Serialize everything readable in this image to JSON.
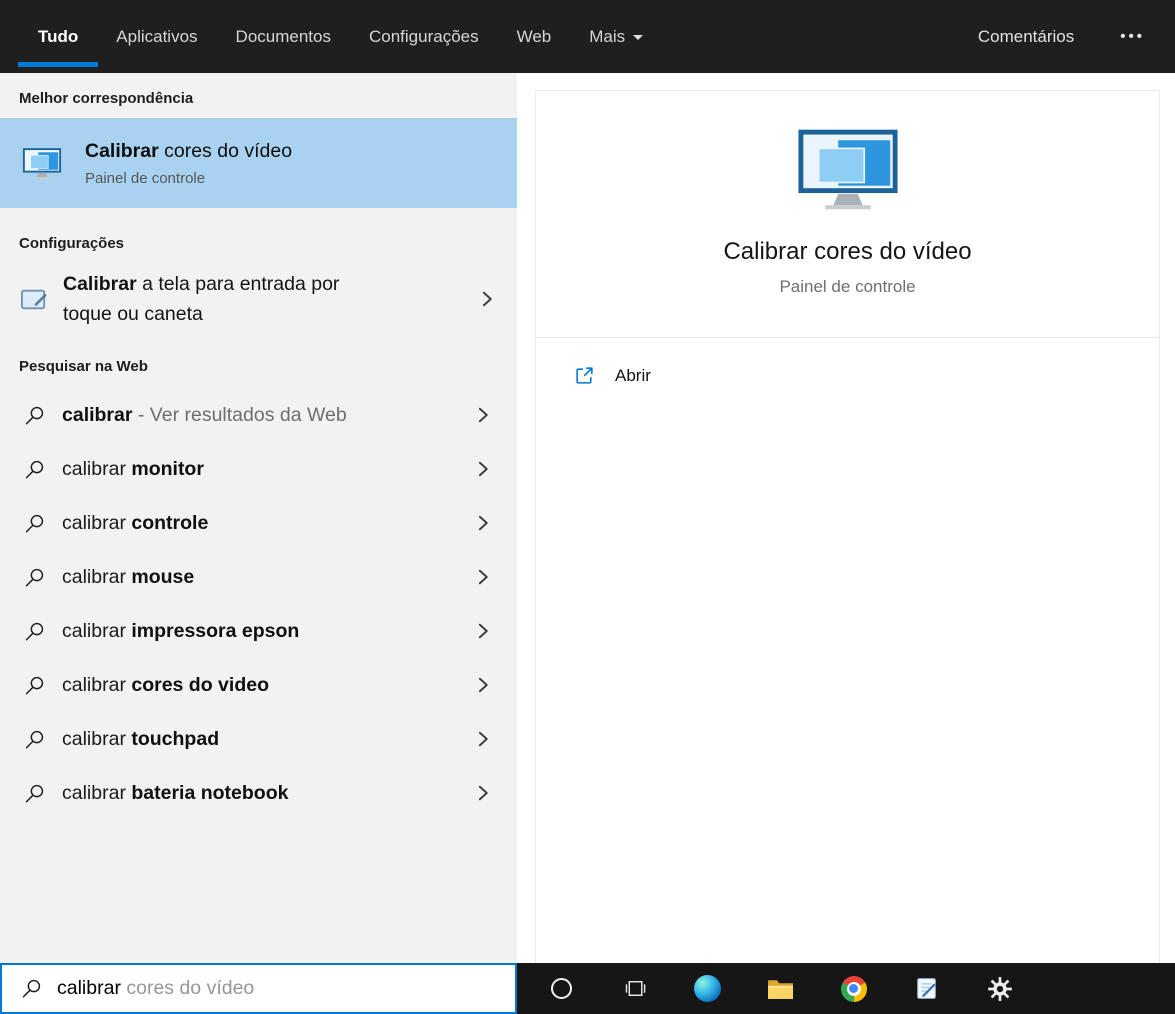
{
  "colors": {
    "accent": "#0078d7",
    "selection": "#a9d2f0",
    "header_bg": "#1f1f1f",
    "taskbar_bg": "#161616",
    "panel_bg": "#f2f2f2"
  },
  "header": {
    "tabs": [
      {
        "label": "Tudo",
        "selected": true
      },
      {
        "label": "Aplicativos",
        "selected": false
      },
      {
        "label": "Documentos",
        "selected": false
      },
      {
        "label": "Configurações",
        "selected": false
      },
      {
        "label": "Web",
        "selected": false
      },
      {
        "label": "Mais",
        "selected": false,
        "has_dropdown": true
      }
    ],
    "feedback": "Comentários",
    "overflow": "•••"
  },
  "best_match": {
    "section_title": "Melhor correspondência",
    "title_bold": "Calibrar",
    "title_rest": " cores do vídeo",
    "subtitle": "Painel de controle",
    "icon": "display-color-icon"
  },
  "settings_section": {
    "section_title": "Configurações",
    "item_bold": "Calibrar",
    "item_rest": " a tela para entrada por toque ou caneta",
    "icon": "tablet-pen-icon"
  },
  "web_section": {
    "section_title": "Pesquisar na Web",
    "suggestions": [
      {
        "typed": "calibrar",
        "rest": " - Ver resultados da Web"
      },
      {
        "typed": "calibrar ",
        "rest": "monitor"
      },
      {
        "typed": "calibrar ",
        "rest": "controle"
      },
      {
        "typed": "calibrar ",
        "rest": "mouse"
      },
      {
        "typed": "calibrar ",
        "rest": "impressora epson"
      },
      {
        "typed": "calibrar ",
        "rest": "cores do video"
      },
      {
        "typed": "calibrar ",
        "rest": "touchpad"
      },
      {
        "typed": "calibrar ",
        "rest": "bateria notebook"
      }
    ]
  },
  "preview": {
    "title": "Calibrar cores do vídeo",
    "subtitle": "Painel de controle",
    "open_label": "Abrir",
    "open_icon": "open-external-icon",
    "icon": "display-color-icon"
  },
  "search_box": {
    "typed": "calibrar",
    "suggestion": " cores do vídeo",
    "icon": "search-icon"
  },
  "taskbar": {
    "icons": [
      "cortana",
      "task-view",
      "edge",
      "file-explorer",
      "chrome",
      "notes",
      "settings"
    ]
  }
}
